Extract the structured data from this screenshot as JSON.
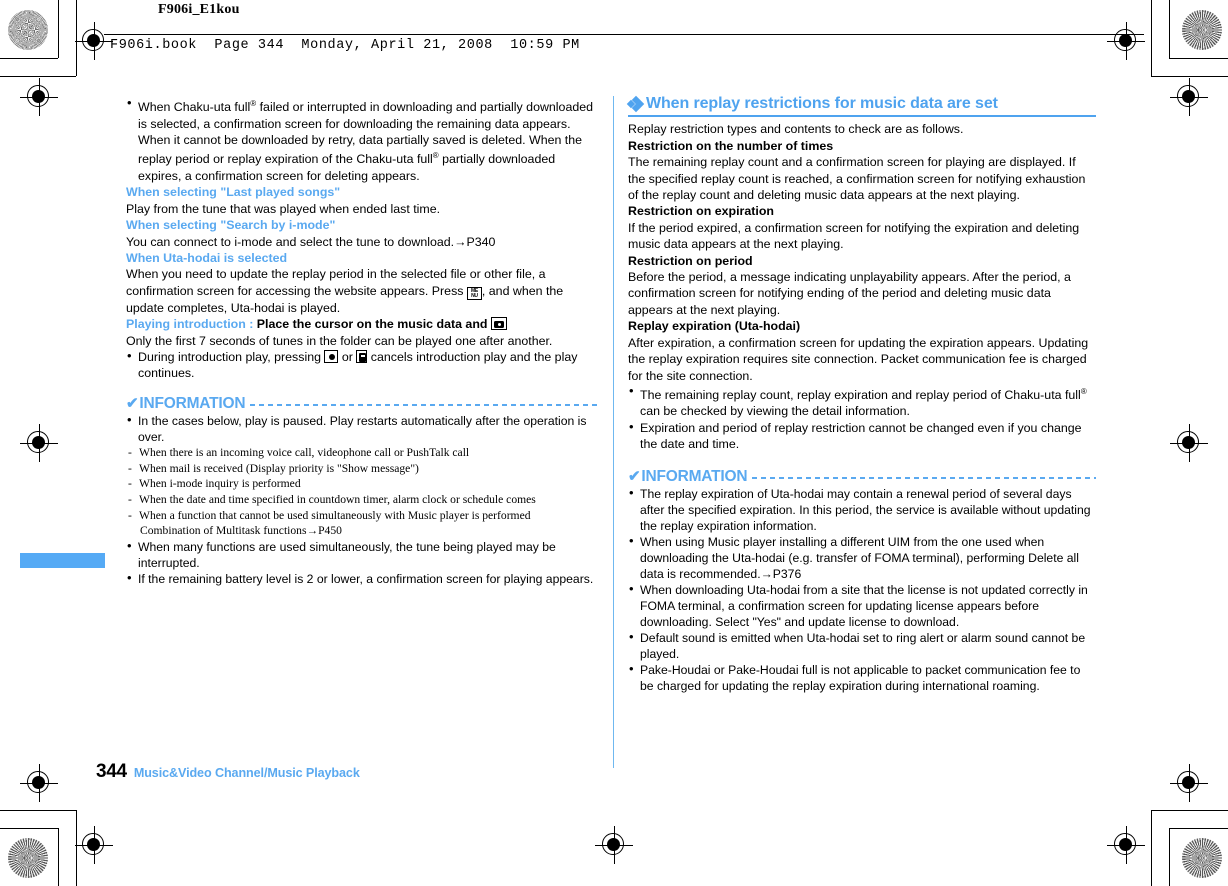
{
  "header": {
    "code": "F906i_E1kou",
    "bookline": "F906i.book  Page 344  Monday, April 21, 2008  10:59 PM"
  },
  "footer": {
    "page_number": "344",
    "chapter": "Music&Video Channel/Music Playback"
  },
  "colors": {
    "accent_blue": "#4fa3ef",
    "light_blue": "#5aa9f0",
    "tab_blue": "#55aaf5"
  },
  "left_column": {
    "lead_bullet": "When Chaku-uta full® failed or interrupted in downloading and partially downloaded is selected, a confirmation screen for downloading the remaining data appears. When it cannot be downloaded by retry, data partially saved is deleted. When the replay period or replay expiration of the Chaku-uta full® partially downloaded expires, a confirmation screen for deleting appears.",
    "subsections": [
      {
        "heading": "When selecting \"Last played songs\"",
        "body": "Play from the tune that was played when ended last time."
      },
      {
        "heading": "When selecting \"Search by i-mode\"",
        "body": "You can connect to i-mode and select the tune to download.→P340"
      },
      {
        "heading": "When Uta-hodai is selected",
        "body": "When you need to update the replay period in the selected file or other file, a confirmation screen for accessing the website appears. Press [MENU], and when the update completes, Uta-hodai is played."
      }
    ],
    "intro_heading": "Playing introduction :",
    "intro_heading_bold": "Place the cursor on the music data and",
    "intro_body": "Only the first 7 seconds of tunes in the folder can be played one after another.",
    "intro_bullet": "During introduction play, pressing [●] or [CLR] cancels introduction play and the play continues.",
    "information": {
      "title": "INFORMATION",
      "items": [
        "In the cases below, play is paused. Play restarts automatically after the operation is over.",
        "When many functions are used simultaneously, the tune being played may be interrupted.",
        "If the remaining battery level is 2 or lower, a confirmation screen for playing appears."
      ],
      "sub_items": [
        "When there is an incoming voice call, videophone call or PushTalk call",
        "When mail is received (Display priority is \"Show message\")",
        "When i-mode inquiry is performed",
        "When the date and time specified in countdown timer, alarm clock or schedule comes",
        "When a function that cannot be used simultaneously with Music player is performed"
      ],
      "sub_item_cont": "Combination of Multitask functions→P450"
    }
  },
  "right_column": {
    "section_title": "When replay restrictions for music data are set",
    "intro": "Replay restriction types and contents to check are as follows.",
    "restrictions": [
      {
        "heading": "Restriction on the number of times",
        "body": "The remaining replay count and a confirmation screen for playing are displayed. If the specified replay count is reached, a confirmation screen for notifying exhaustion of the replay count and deleting music data appears at the next playing."
      },
      {
        "heading": "Restriction on expiration",
        "body": "If the period expired, a confirmation screen for notifying the expiration and deleting music data appears at the next playing."
      },
      {
        "heading": "Restriction on period",
        "body": "Before the period, a message indicating unplayability appears. After the period, a confirmation screen for notifying ending of the period and deleting music data appears at the next playing."
      },
      {
        "heading": "Replay expiration (Uta-hodai)",
        "body": "After expiration, a confirmation screen for updating the expiration appears. Updating the replay expiration requires site connection. Packet communication fee is charged for the site connection."
      }
    ],
    "bullets": [
      "The remaining replay count, replay expiration and replay period of Chaku-uta full® can be checked by viewing the detail information.",
      "Expiration and period of replay restriction cannot be changed even if you change the date and time."
    ],
    "information": {
      "title": "INFORMATION",
      "items": [
        "The replay expiration of Uta-hodai may contain a renewal period of several days after the specified expiration. In this period, the service is available without updating the replay expiration information.",
        "When using Music player installing a different UIM from the one used when downloading the Uta-hodai (e.g. transfer of FOMA terminal), performing Delete all data is recommended.→P376",
        "When downloading Uta-hodai from a site that the license is not updated correctly in FOMA terminal, a confirmation screen for updating license appears before downloading. Select \"Yes\" and update license to download.",
        "Default sound is emitted when Uta-hodai set to ring alert or alarm sound cannot be played.",
        "Pake-Houdai or Pake-Houdai full is not applicable to packet communication fee to be charged for updating the replay expiration during international roaming."
      ]
    }
  }
}
